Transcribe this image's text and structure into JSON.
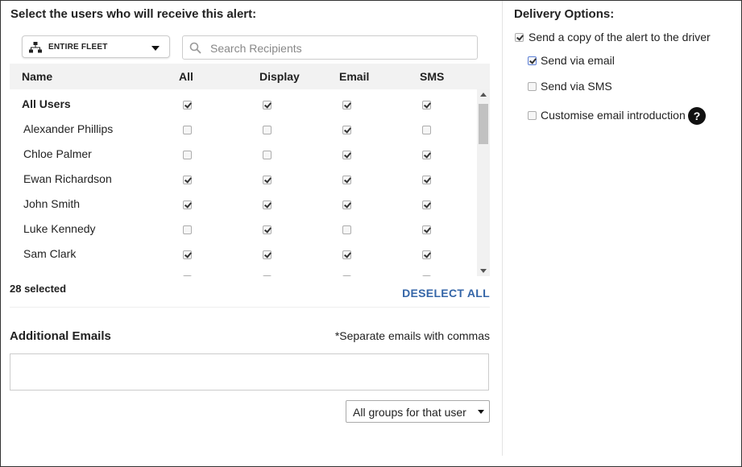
{
  "recipients": {
    "title": "Select the users who will receive this alert:",
    "fleet_selector": {
      "label": "ENTIRE FLEET",
      "icon": "hierarchy-icon"
    },
    "search": {
      "placeholder": "Search Recipients",
      "value": ""
    },
    "columns": [
      "Name",
      "All",
      "Display",
      "Email",
      "SMS"
    ],
    "rows": [
      {
        "name": "All Users",
        "bold": true,
        "all": true,
        "display": true,
        "email": true,
        "sms": true
      },
      {
        "name": "Alexander Phillips",
        "all": false,
        "display": false,
        "email": true,
        "sms": false
      },
      {
        "name": "Chloe Palmer",
        "all": false,
        "display": false,
        "email": true,
        "sms": true
      },
      {
        "name": "Ewan Richardson",
        "all": true,
        "display": true,
        "email": true,
        "sms": true
      },
      {
        "name": "John Smith",
        "all": true,
        "display": true,
        "email": true,
        "sms": true
      },
      {
        "name": "Luke Kennedy",
        "all": false,
        "display": true,
        "email": false,
        "sms": true
      },
      {
        "name": "Sam Clark",
        "all": true,
        "display": true,
        "email": true,
        "sms": true
      },
      {
        "name": "...",
        "all": false,
        "display": false,
        "email": false,
        "sms": false
      }
    ],
    "selected_count": "28 selected",
    "deselect_all": "DESELECT ALL"
  },
  "additional_emails": {
    "title": "Additional Emails",
    "hint": "*Separate emails with commas",
    "value": "",
    "group_select": {
      "value": "All groups for that user"
    }
  },
  "delivery": {
    "title": "Delivery Options:",
    "send_copy": {
      "label": "Send a copy of the alert to the driver",
      "checked": true
    },
    "via_email": {
      "label": "Send via email",
      "checked": true
    },
    "via_sms": {
      "label": "Send via SMS",
      "checked": false
    },
    "customise": {
      "label": "Customise email introduction",
      "checked": false
    },
    "help_symbol": "?"
  },
  "colors": {
    "link": "#3566a8",
    "header_bg": "#f2f2f2"
  }
}
